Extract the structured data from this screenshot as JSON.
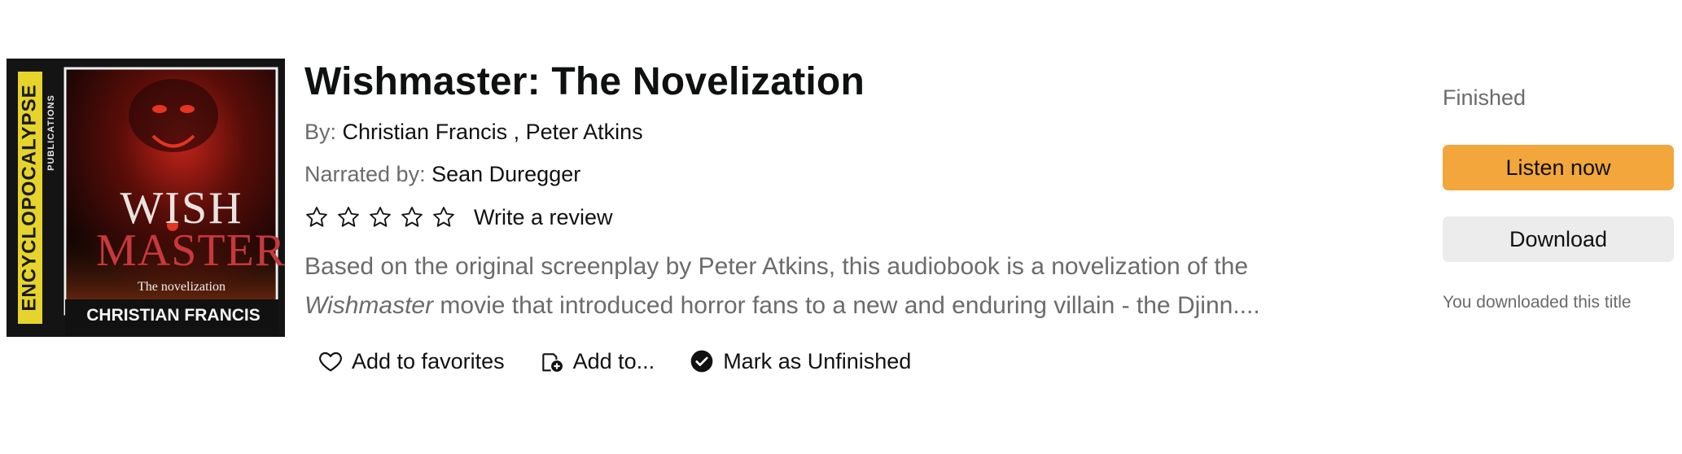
{
  "book": {
    "title": "Wishmaster: The Novelization",
    "by_label": "By:",
    "authors": [
      "Christian Francis",
      "Peter Atkins"
    ],
    "author_separator": " , ",
    "narrated_label": "Narrated by:",
    "narrator": "Sean Duregger",
    "rating_stars_filled": 0,
    "rating_stars_total": 5,
    "write_review": "Write a review",
    "description_before": "Based on the original screenplay by Peter Atkins, this audiobook is a novelization of the ",
    "description_italic": "Wishmaster",
    "description_after": " movie that introduced horror fans to a new and enduring villain - the Djinn...."
  },
  "cover": {
    "side_text_top": "ENCYCL",
    "side_text_bottom": "POCALYPSE",
    "side_text_small": "PUBLICATIONS",
    "title_line1": "WISH",
    "title_line2": "MASTER",
    "subtitle": "The novelization",
    "author": "CHRISTIAN FRANCIS"
  },
  "actions": {
    "favorites": "Add to favorites",
    "add_to": "Add to...",
    "mark_unfinished": "Mark as Unfinished"
  },
  "status_panel": {
    "status": "Finished",
    "listen_now": "Listen now",
    "download": "Download",
    "downloaded_note": "You downloaded this title"
  },
  "colors": {
    "primary_button": "#f3a63c",
    "secondary_button": "#ececec",
    "muted_text": "#6b6b6b"
  }
}
